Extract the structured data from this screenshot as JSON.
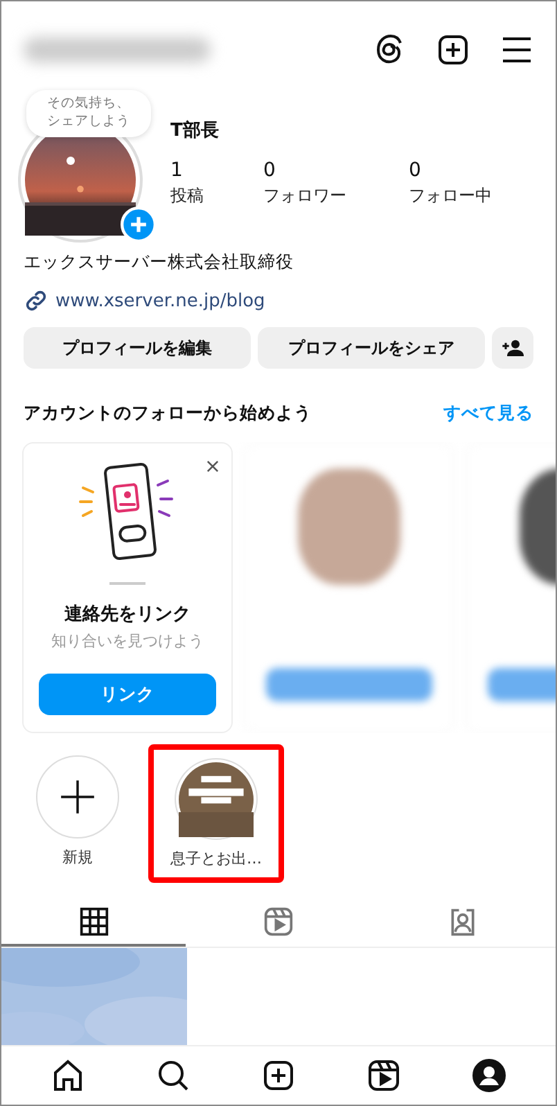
{
  "profile": {
    "note": [
      "その気持ち、",
      "シェアしよう"
    ],
    "name": "T部長",
    "stats": [
      {
        "value": "1",
        "label": "投稿"
      },
      {
        "value": "0",
        "label": "フォロワー"
      },
      {
        "value": "0",
        "label": "フォロー中"
      }
    ],
    "bio": "エックスサーバー株式会社取締役",
    "link": "www.xserver.ne.jp/blog"
  },
  "buttons": [
    "プロフィールを編集",
    "プロフィールをシェア"
  ],
  "suggestions": {
    "title": "アカウントのフォローから始めよう",
    "see_all": "すべて見る",
    "card": {
      "title": "連絡先をリンク",
      "subtitle": "知り合いを見つけよう",
      "button": "リンク"
    }
  },
  "highlights": [
    {
      "kind": "new",
      "label": "新規",
      "marked": false
    },
    {
      "kind": "story",
      "label": "息子とお出…",
      "marked": true
    }
  ],
  "profile_tabs": [
    {
      "kind": "grid",
      "selected": true
    },
    {
      "kind": "reels",
      "selected": false
    },
    {
      "kind": "tagged",
      "selected": false
    }
  ],
  "nav": [
    {
      "kind": "home",
      "selected": false
    },
    {
      "kind": "search",
      "selected": false
    },
    {
      "kind": "create",
      "selected": false
    },
    {
      "kind": "reels",
      "selected": false
    },
    {
      "kind": "profile",
      "selected": true
    }
  ]
}
